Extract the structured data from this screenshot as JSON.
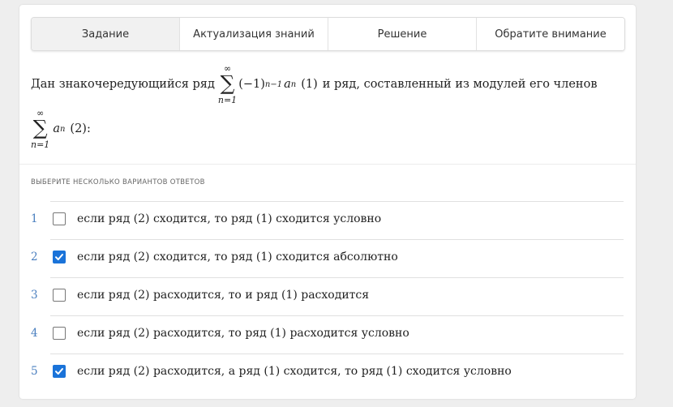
{
  "tabs": [
    {
      "label": "Задание",
      "active": true
    },
    {
      "label": "Актуализация знаний",
      "active": false
    },
    {
      "label": "Решение",
      "active": false
    },
    {
      "label": "Обратите внимание",
      "active": false
    }
  ],
  "statement": {
    "part1": "Дан знакочередующийся ряд",
    "sum_sup": "∞",
    "sum_sub": "n=1",
    "term1_base": "(−1)",
    "term1_exp": "n−1",
    "term_var": "a",
    "term_idx": "n",
    "label1": "(1)",
    "part2": "и ряд, составленный из модулей его членов",
    "label2": "(2):"
  },
  "instruction": "ВЫБЕРИТЕ НЕСКОЛЬКО ВАРИАНТОВ ОТВЕТОВ",
  "options": [
    {
      "num": "1",
      "text": "если ряд (2) сходится, то ряд (1) сходится условно",
      "checked": false
    },
    {
      "num": "2",
      "text": "если ряд (2) сходится, то ряд (1) сходится абсолютно",
      "checked": true
    },
    {
      "num": "3",
      "text": "если ряд (2) расходится, то и ряд (1) расходится",
      "checked": false
    },
    {
      "num": "4",
      "text": "если ряд (2) расходится, то ряд (1) расходится условно",
      "checked": false
    },
    {
      "num": "5",
      "text": "если ряд (2) расходится, а ряд (1) сходится, то ряд (1) сходится условно",
      "checked": true
    }
  ],
  "colors": {
    "checkbox_checked": "#1a73d9",
    "option_number": "#4a7fbf"
  },
  "icons": {
    "checkbox_checked": "checkmark-icon"
  }
}
